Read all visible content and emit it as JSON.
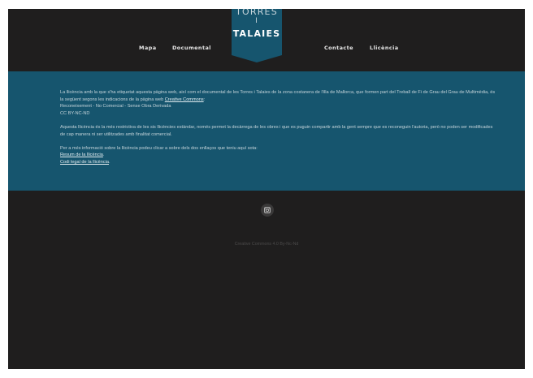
{
  "header": {
    "nav_left": [
      "Mapa",
      "Documental"
    ],
    "nav_right": [
      "Contacte",
      "Llicència"
    ],
    "logo": {
      "line1": "TORRES",
      "line2": "I",
      "line3": "TALAIES"
    }
  },
  "license": {
    "p1_text": "La llicència amb la que s'ha etiquetat aquesta pàgina web, així com el documental de les Torres i Talaies de la zona costanera de l'illa de Mallorca, que formen part del Treball de Fi de Grau del Grau de Multimèdia, és la següent segons les indicacions de la pàgina web",
    "p1_link": "Creative Commons",
    "p1_end": ":",
    "line_reconeixement": "Reconeixement - No Comercial - Sense Obra Derivada",
    "line_code": "CC BY-NC-ND",
    "p2": "Aquesta llicència és la més restrictiva de les sis llicències estàndar, només permet la decàrrega de les obres i que es puguin compartir amb la gent sempre que es reconeguin l'autoria, però no poden ser modificades de cap manera ni ser utilitzades amb finalitat comercial.",
    "p3": "Per a més informació sobre la llicència podeu clicar a sobre dels dos enllaços que teniu aquí sota:",
    "link1": "Resum de la llicència",
    "link1_end": ".",
    "link2": "Codi legal de la llicència",
    "link2_end": "."
  },
  "footer": {
    "social_icon": "instagram-icon",
    "copyright": "Creative Commons 4.0 By-Nc-Nd"
  },
  "colors": {
    "background": "#1f1e1e",
    "accent": "#16556e"
  }
}
